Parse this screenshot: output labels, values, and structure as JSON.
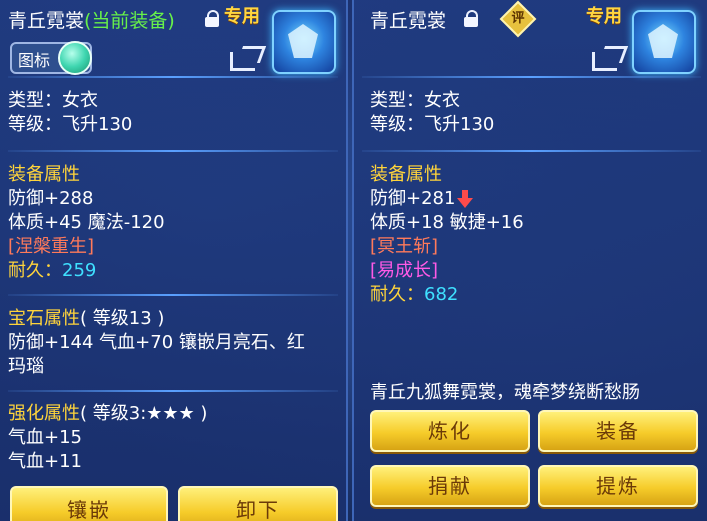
{
  "left": {
    "title": "青丘霓裳",
    "title_sub": "(当前装备)",
    "exclusive": "专用",
    "toggle_label": "图标",
    "type_line": "类型：女衣",
    "level_line": "等级：飞升130",
    "equip_attr_title": "装备属性",
    "defense": "防御+288",
    "stats": "体质+45 魔法-120",
    "special": "[涅槃重生]",
    "durability_label": "耐久：",
    "durability_value": "259",
    "gem_title": "宝石属性",
    "gem_level": "( 等级13 )",
    "gem_line1": "防御+144 气血+70 镶嵌月亮石、红",
    "gem_line2": "玛瑙",
    "enhance_title": "强化属性",
    "enhance_level": "( 等级3:★★★ )",
    "enhance_line1": "气血+15",
    "enhance_line2": "气血+11",
    "buttons": {
      "inlay": "镶嵌",
      "unequip": "卸下"
    }
  },
  "right": {
    "title": "青丘霓裳",
    "exclusive": "专用",
    "eval_label": "评",
    "type_line": "类型：女衣",
    "level_line": "等级：飞升130",
    "equip_attr_title": "装备属性",
    "defense": "防御+281",
    "stats": "体质+18 敏捷+16",
    "special1": "[冥王斩]",
    "special2": "[易成长]",
    "durability_label": "耐久：",
    "durability_value": "682",
    "description": "青丘九狐舞霓裳，魂牵梦绕断愁肠",
    "buttons": {
      "refine": "炼化",
      "equip": "装备",
      "donate": "捐献",
      "extract": "提炼"
    }
  },
  "icons": [
    "lock-open-icon",
    "share-icon",
    "item-robe-icon",
    "eval-icon",
    "arrow-down-icon"
  ],
  "colors": {
    "section": "#ffd43b",
    "special_red": "#ff7a5a",
    "special_magenta": "#ff5ae6",
    "durability_value": "#3fe0ff",
    "button": "#f6cc2a"
  }
}
